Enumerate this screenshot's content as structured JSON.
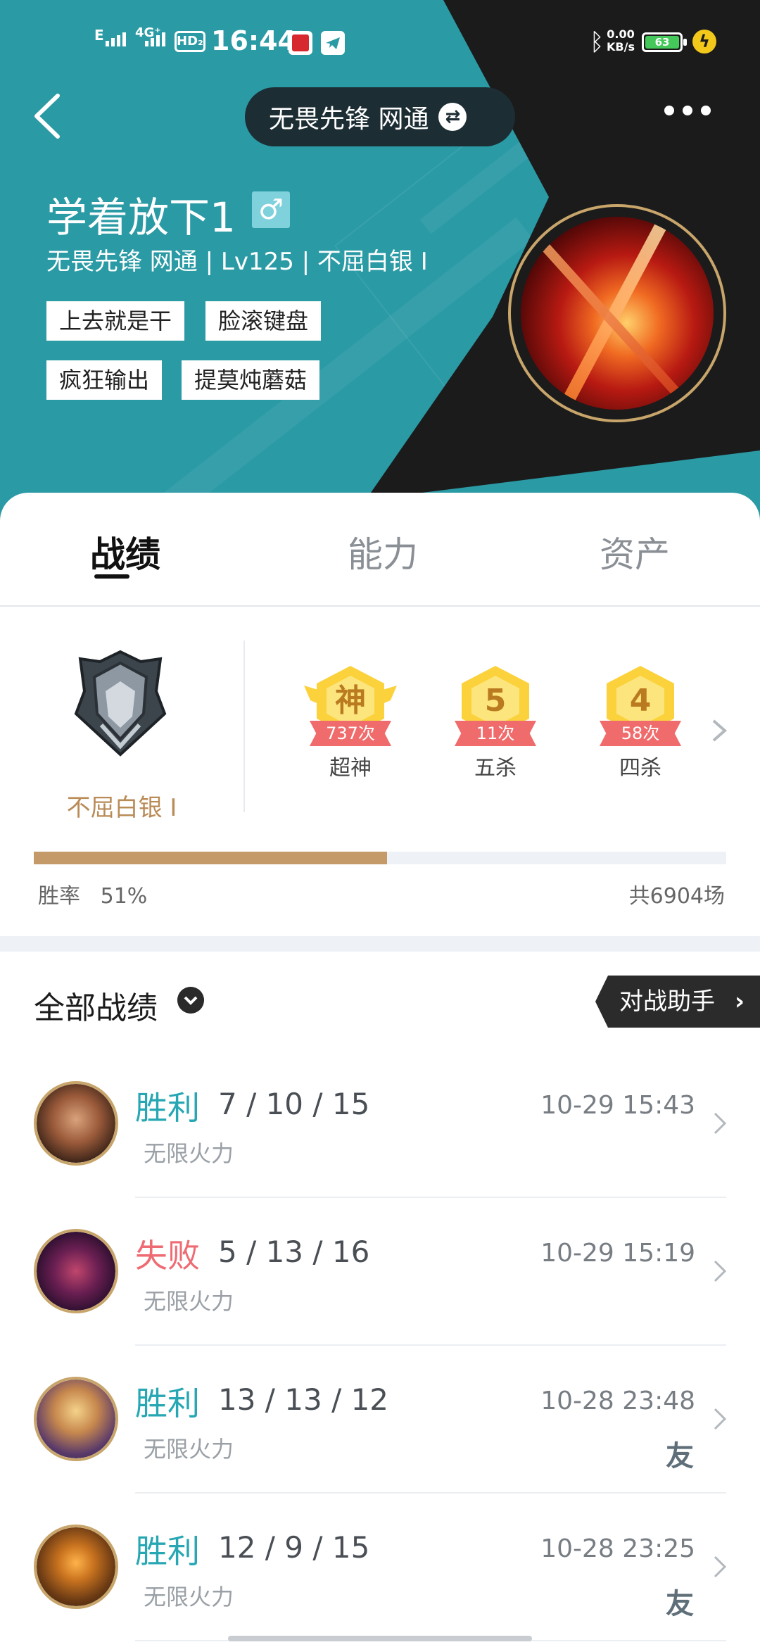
{
  "status_bar": {
    "network_1": "E",
    "network_2": "4G⁺",
    "hd": "HD₂",
    "time": "16:44",
    "speed_value": "0.00",
    "speed_unit": "KB/s",
    "battery": "63"
  },
  "header": {
    "server_pill": "无畏先锋 网通",
    "player_name": "学着放下1",
    "gender_symbol": "♂",
    "player_info": "无畏先锋 网通 | Lv125 | 不屈白银 I",
    "tags": [
      "上去就是干",
      "脸滚键盘",
      "疯狂输出",
      "提莫炖蘑菇"
    ]
  },
  "tabs": [
    {
      "label": "战绩",
      "active": true
    },
    {
      "label": "能力",
      "active": false
    },
    {
      "label": "资产",
      "active": false
    }
  ],
  "stats": {
    "rank_label": "不屈白银 I",
    "medals": [
      {
        "glyph": "神",
        "count": "737次",
        "label": "超神"
      },
      {
        "glyph": "5",
        "count": "11次",
        "label": "五杀"
      },
      {
        "glyph": "4",
        "count": "58次",
        "label": "四杀"
      }
    ],
    "win_rate_label": "胜率",
    "win_rate_value": "51%",
    "win_rate_fraction": 0.51,
    "total_games": "共6904场"
  },
  "matches_header": {
    "title": "全部战绩",
    "assistant_button": "对战助手"
  },
  "matches": [
    {
      "result": "胜利",
      "outcome": "win",
      "kda": "7 / 10 / 15",
      "mode": "无限火力",
      "time": "10-29 15:43",
      "friend": ""
    },
    {
      "result": "失败",
      "outcome": "lose",
      "kda": "5 / 13 / 16",
      "mode": "无限火力",
      "time": "10-29 15:19",
      "friend": ""
    },
    {
      "result": "胜利",
      "outcome": "win",
      "kda": "13 / 13 / 12",
      "mode": "无限火力",
      "time": "10-28 23:48",
      "friend": "友"
    },
    {
      "result": "胜利",
      "outcome": "win",
      "kda": "12 / 9 / 15",
      "mode": "无限火力",
      "time": "10-28 23:25",
      "friend": "友"
    }
  ],
  "colors": {
    "header_teal": "#2a9aa5",
    "header_dark": "#1b1b1b",
    "win": "#26a7b3",
    "lose": "#ef6b73",
    "rank_gold": "#b98b57",
    "bar_fill": "#c49a68"
  }
}
